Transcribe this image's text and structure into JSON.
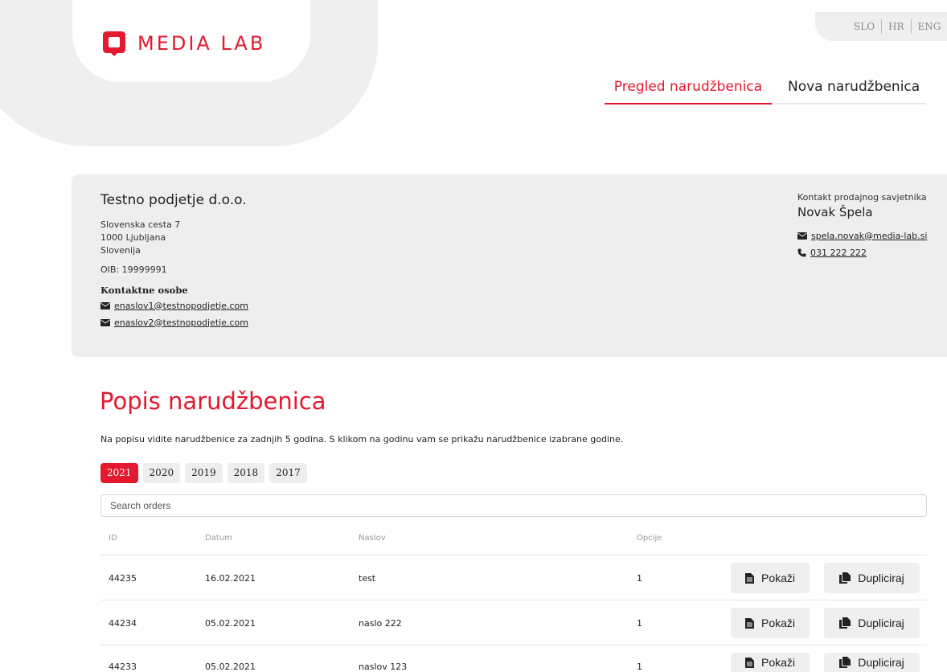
{
  "brand": {
    "logo_text": "MEDIA LAB",
    "accent": "#e3192f"
  },
  "languages": [
    "SLO",
    "HR",
    "ENG"
  ],
  "nav": {
    "tabs": [
      "Pregled narudžbenica",
      "Nova narudžbenica"
    ],
    "active": 0
  },
  "company": {
    "name": "Testno podjetje d.o.o.",
    "address": [
      "Slovenska cesta 7",
      "1000 Ljubljana",
      "Slovenija"
    ],
    "oib": "OIB: 19999991",
    "contacts_title": "Kontaktne osobe",
    "emails": [
      "enaslov1@testnopodjetje.com",
      "enaslov2@testnopodjetje.com"
    ]
  },
  "advisor": {
    "label": "Kontakt prodajnog savjetnika",
    "name": "Novak Špela",
    "email": "spela.novak@media-lab.si",
    "phone": "031 222 222"
  },
  "orders": {
    "title": "Popis narudžbenica",
    "description": "Na popisu vidite narudžbenice za zadnjih 5 godina. S klikom na godinu vam se prikažu narudžbenice izabrane godine.",
    "years": [
      "2021",
      "2020",
      "2019",
      "2018",
      "2017"
    ],
    "active_year": "2021",
    "search_placeholder": "Search orders",
    "columns": [
      "ID",
      "Datum",
      "Naslov",
      "Opcije"
    ],
    "rows": [
      {
        "id": "44235",
        "date": "16.02.2021",
        "title": "test",
        "options": "1"
      },
      {
        "id": "44234",
        "date": "05.02.2021",
        "title": "naslo 222",
        "options": "1"
      },
      {
        "id": "44233",
        "date": "05.02.2021",
        "title": "naslov 123",
        "options": "1"
      }
    ],
    "show_label": "Pokaži",
    "duplicate_label": "Dupliciraj"
  }
}
